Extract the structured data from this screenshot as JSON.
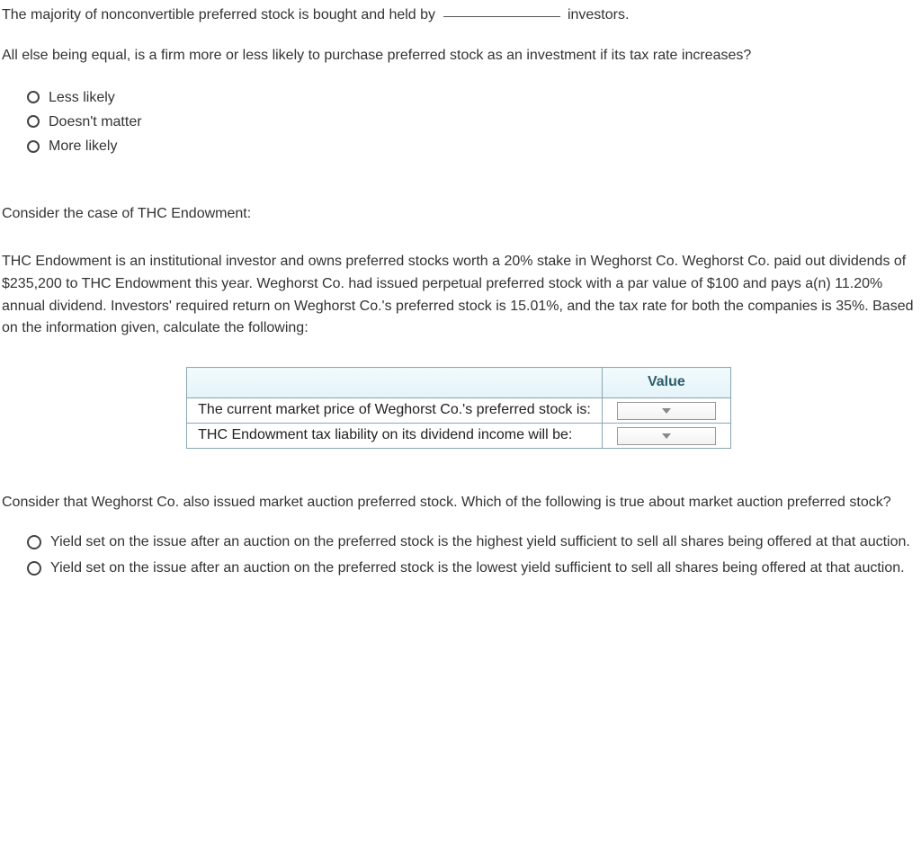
{
  "q1": {
    "text_before": "The majority of nonconvertible preferred stock is bought and held by ",
    "text_after": " investors."
  },
  "q2": {
    "prompt": "All else being equal, is a firm more or less likely to purchase preferred stock as an investment if its tax rate increases?",
    "options": [
      "Less likely",
      "Doesn't matter",
      "More likely"
    ]
  },
  "case_intro": "Consider the case of THC Endowment:",
  "case_body": "THC Endowment is an institutional investor and owns preferred stocks worth a 20% stake in Weghorst Co. Weghorst Co. paid out dividends of $235,200 to THC Endowment this year. Weghorst Co. had issued perpetual preferred stock with a par value of $100 and pays a(n) 11.20% annual dividend. Investors' required return on Weghorst Co.'s preferred stock is 15.01%, and the tax rate for both the companies is 35%. Based on the information given, calculate the following:",
  "table": {
    "header_value": "Value",
    "rows": [
      "The current market price of Weghorst Co.'s preferred stock is:",
      "THC Endowment tax liability on its dividend income will be:"
    ]
  },
  "q4": {
    "prompt": "Consider that Weghorst Co. also issued market auction preferred stock. Which of the following is true about market auction preferred stock?",
    "options": [
      "Yield set on the issue after an auction on the preferred stock is the highest yield sufficient to sell all shares being offered at that auction.",
      "Yield set on the issue after an auction on the preferred stock is the lowest yield sufficient to sell all shares being offered at that auction."
    ]
  }
}
